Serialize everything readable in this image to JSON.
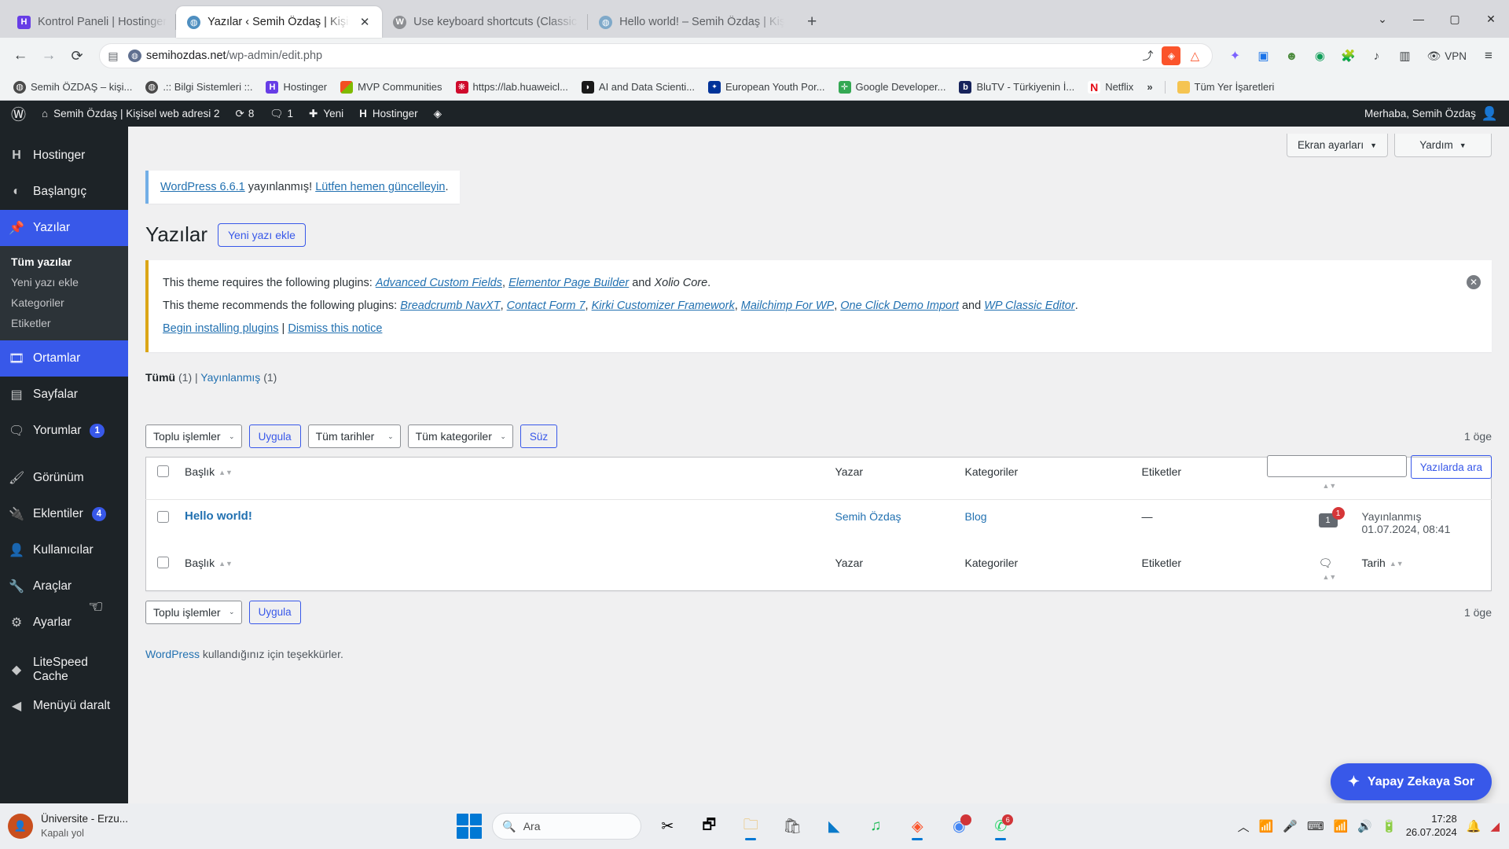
{
  "browser": {
    "tabs": [
      {
        "title": "Kontrol Paneli | Hostinger",
        "icon": "hostinger-icon",
        "active": false
      },
      {
        "title": "Yazılar ‹ Semih Özdaş | Kişisel w",
        "icon": "globe-icon",
        "active": true
      },
      {
        "title": "Use keyboard shortcuts (Classic Edit",
        "icon": "wordpress-icon",
        "active": false
      },
      {
        "title": "Hello world! – Semih Özdaş | Kişise",
        "icon": "globe-icon",
        "active": false
      }
    ],
    "new_tab_label": "+",
    "window_controls": {
      "minimize": "—",
      "maximize": "▢",
      "close": "✕",
      "more": "⌄"
    },
    "nav": {
      "back": "←",
      "forward": "→",
      "reload": "⟳",
      "reading_list": "🔖",
      "site_info": "globe-icon",
      "share": "share-icon",
      "brave_shield": "shield-icon",
      "brave_rewards": "triangle-icon"
    },
    "address": {
      "host": "semihozdas.net",
      "path": "/wp-admin/edit.php"
    },
    "vpn_label": "VPN",
    "toolbar_extensions": [
      "leo-ai-icon",
      "extension-icon",
      "people-icon",
      "profile-icon",
      "puzzle-icon",
      "music-icon",
      "sidebar-icon"
    ],
    "menu_label": "⋮≡",
    "bookmarks": [
      {
        "label": "Semih ÖZDAŞ – kişi...",
        "icon": "globe-icon",
        "color": "#4a4a4a"
      },
      {
        "label": ".:: Bilgi Sistemleri ::.",
        "icon": "globe-icon",
        "color": "#4a4a4a"
      },
      {
        "label": "Hostinger",
        "icon": "hostinger-icon",
        "color": "#673de6"
      },
      {
        "label": "MVP Communities",
        "icon": "microsoft-icon",
        "color": "#f25022"
      },
      {
        "label": "https://lab.huaweicl...",
        "icon": "huawei-icon",
        "color": "#cf0a2c"
      },
      {
        "label": "AI and Data Scienti...",
        "icon": "ai-icon",
        "color": "#1a1a1a"
      },
      {
        "label": "European Youth Por...",
        "icon": "eu-icon",
        "color": "#003399"
      },
      {
        "label": "Google Developer...",
        "icon": "google-dev-icon",
        "color": "#34a853"
      },
      {
        "label": "BluTV - Türkiyenin İ...",
        "icon": "blutv-icon",
        "color": "#17235b"
      },
      {
        "label": "Netflix",
        "icon": "netflix-icon",
        "color": "#e50914"
      }
    ],
    "bookmarks_overflow": "»",
    "bookmarks_all": {
      "label": "Tüm Yer İşaretleri",
      "icon": "folder-icon"
    }
  },
  "wp_admin_bar": {
    "logo": "wordpress-icon",
    "site_name": "Semih Özdaş | Kişisel web adresi 2",
    "updates_count": "8",
    "comments_count": "1",
    "new_label": "Yeni",
    "hostinger_label": "Hostinger",
    "greeting": "Merhaba, Semih Özdaş"
  },
  "sidebar": {
    "items": [
      {
        "label": "Hostinger",
        "icon": "hostinger-icon",
        "state": "normal",
        "badge": ""
      },
      {
        "label": "Başlangıç",
        "icon": "dashboard-icon",
        "state": "normal",
        "badge": ""
      },
      {
        "label": "Yazılar",
        "icon": "pin-icon",
        "state": "current",
        "badge": ""
      },
      {
        "label": "Ortamlar",
        "icon": "media-icon",
        "state": "hover",
        "badge": ""
      },
      {
        "label": "Sayfalar",
        "icon": "pages-icon",
        "state": "normal",
        "badge": ""
      },
      {
        "label": "Yorumlar",
        "icon": "comments-icon",
        "state": "normal",
        "badge": "1"
      },
      {
        "label": "Görünüm",
        "icon": "appearance-icon",
        "state": "normal",
        "badge": ""
      },
      {
        "label": "Eklentiler",
        "icon": "plugins-icon",
        "state": "normal",
        "badge": "4"
      },
      {
        "label": "Kullanıcılar",
        "icon": "users-icon",
        "state": "normal",
        "badge": ""
      },
      {
        "label": "Araçlar",
        "icon": "tools-icon",
        "state": "normal",
        "badge": ""
      },
      {
        "label": "Ayarlar",
        "icon": "settings-icon",
        "state": "normal",
        "badge": ""
      },
      {
        "label": "LiteSpeed Cache",
        "icon": "litespeed-icon",
        "state": "normal",
        "badge": ""
      },
      {
        "label": "Menüyü daralt",
        "icon": "collapse-icon",
        "state": "normal",
        "badge": ""
      }
    ],
    "submenu": [
      {
        "label": "Tüm yazılar",
        "current": true
      },
      {
        "label": "Yeni yazı ekle",
        "current": false
      },
      {
        "label": "Kategoriler",
        "current": false
      },
      {
        "label": "Etiketler",
        "current": false
      }
    ]
  },
  "screen_options": {
    "screen_settings": "Ekran ayarları",
    "help": "Yardım",
    "chevron": "▼"
  },
  "update_notice": {
    "link_version": "WordPress 6.6.1",
    "text_mid": " yayınlanmış! ",
    "link_action": "Lütfen hemen güncelleyin",
    "text_end": "."
  },
  "page": {
    "title": "Yazılar",
    "add_new": "Yeni yazı ekle"
  },
  "tgmpa": {
    "required_prefix": "This theme requires the following plugins: ",
    "required_plugins": [
      "Advanced Custom Fields",
      "Elementor Page Builder"
    ],
    "required_and": " and ",
    "required_last": "Xolio Core",
    "required_suffix": ".",
    "recommend_prefix": "This theme recommends the following plugins: ",
    "recommend_plugins": [
      "Breadcrumb NavXT",
      "Contact Form 7",
      "Kirki Customizer Framework",
      "Mailchimp For WP",
      "One Click Demo Import"
    ],
    "recommend_and": " and ",
    "recommend_last": "WP Classic Editor",
    "recommend_suffix": ".",
    "action_install": "Begin installing plugins",
    "action_sep": " | ",
    "action_dismiss": "Dismiss this notice",
    "close_icon": "✕"
  },
  "subsubsub": {
    "all_label": "Tümü",
    "all_count": "(1)",
    "separator": "|",
    "published_label": "Yayınlanmış",
    "published_count": "(1)"
  },
  "search": {
    "value": "",
    "placeholder": "",
    "button": "Yazılarda ara"
  },
  "tablenav": {
    "bulk_actions": "Toplu işlemler",
    "apply": "Uygula",
    "all_dates": "Tüm tarihler",
    "all_categories": "Tüm kategoriler",
    "filter": "Süz",
    "item_count": "1 öge",
    "chevron": "⌄"
  },
  "table": {
    "columns": [
      "Başlık",
      "Yazar",
      "Kategoriler",
      "Etiketler",
      "comments-icon",
      "Tarih"
    ],
    "rows": [
      {
        "title": "Hello world!",
        "author": "Semih Özdaş",
        "categories": "Blog",
        "tags": "—",
        "comments": "1",
        "comments_badge": "1",
        "date_status": "Yayınlanmış",
        "date_value": "01.07.2024, 08:41"
      }
    ]
  },
  "footer": {
    "link": "WordPress",
    "text": " kullandığınız için teşekkürler."
  },
  "ai_fab": {
    "label": "Yapay Zekaya Sor",
    "icon": "sparkle-icon"
  },
  "taskbar": {
    "user_name": "Üniversite - Erzu...",
    "user_status": "Kapalı yol",
    "search_placeholder": "Ara",
    "search_icon": "search-icon",
    "start_icon": "windows-icon",
    "apps": [
      {
        "icon": "snip-icon",
        "name": "snipping-tool",
        "running": false,
        "badge": ""
      },
      {
        "icon": "taskview-icon",
        "name": "task-view",
        "running": false,
        "badge": ""
      },
      {
        "icon": "explorer-icon",
        "name": "file-explorer",
        "running": true,
        "badge": ""
      },
      {
        "icon": "store-icon",
        "name": "microsoft-store",
        "running": false,
        "badge": ""
      },
      {
        "icon": "vscode-icon",
        "name": "visual-studio-code",
        "running": false,
        "badge": ""
      },
      {
        "icon": "spotify-icon",
        "name": "spotify",
        "running": false,
        "badge": ""
      },
      {
        "icon": "brave-icon",
        "name": "brave-browser",
        "running": true,
        "badge": ""
      },
      {
        "icon": "chrome-icon",
        "name": "google-chrome",
        "running": false,
        "badge": ""
      },
      {
        "icon": "whatsapp-icon",
        "name": "whatsapp",
        "running": true,
        "badge": "6"
      }
    ],
    "tray": [
      "chevron-up-icon",
      "graph-icon",
      "mic-icon",
      "keyboard-icon",
      "wifi-icon",
      "volume-icon",
      "battery-icon"
    ],
    "clock_time": "17:28",
    "clock_date": "26.07.2024",
    "notification_icon": "bell-icon",
    "action_center": "action-center-icon"
  }
}
